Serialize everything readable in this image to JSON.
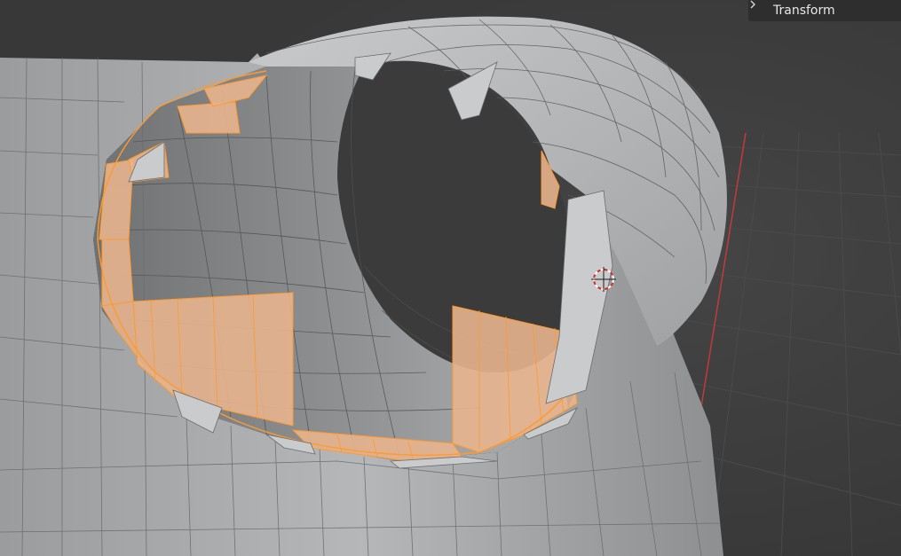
{
  "sidebar": {
    "panel_label": "Transform",
    "panel_icon": "chevron-right-icon",
    "panel_state": "collapsed"
  },
  "viewport": {
    "background_color": "#3d3d3d",
    "mesh_color": "#a9abad",
    "selected_face_color": "#e8b48e",
    "selected_edge_color": "#ff9a2e",
    "x_axis_color": "#c23a3a"
  }
}
